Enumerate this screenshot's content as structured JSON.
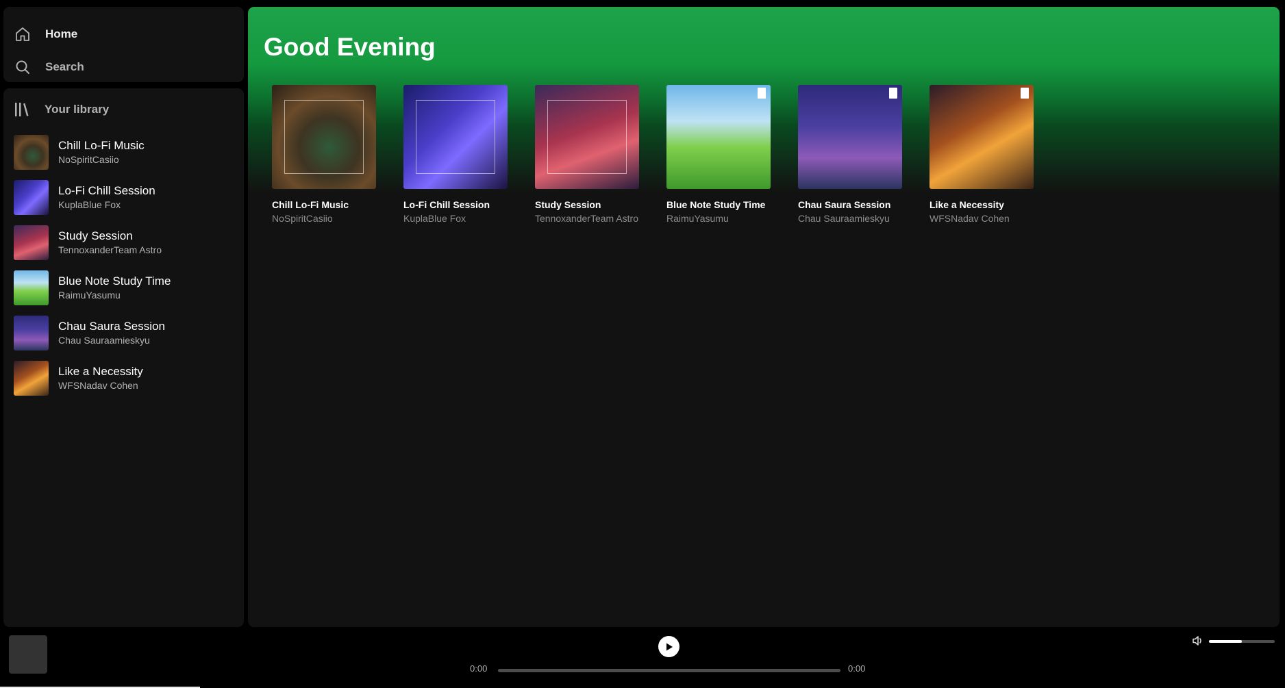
{
  "nav": {
    "home_label": "Home",
    "search_label": "Search"
  },
  "library": {
    "header_label": "Your library",
    "items": [
      {
        "title": "Chill Lo-Fi Music",
        "subtitle": "NoSpiritCasiio"
      },
      {
        "title": "Lo-Fi Chill Session",
        "subtitle": "KuplaBlue Fox"
      },
      {
        "title": "Study Session",
        "subtitle": "TennoxanderTeam Astro"
      },
      {
        "title": "Blue Note Study Time",
        "subtitle": "RaimuYasumu"
      },
      {
        "title": "Chau Saura Session",
        "subtitle": "Chau Sauraamieskyu"
      },
      {
        "title": "Like a Necessity",
        "subtitle": "WFSNadav Cohen"
      }
    ]
  },
  "main": {
    "greeting": "Good Evening",
    "cards": [
      {
        "title": "Chill Lo-Fi Music",
        "subtitle": "NoSpiritCasiio"
      },
      {
        "title": "Lo-Fi Chill Session",
        "subtitle": "KuplaBlue Fox"
      },
      {
        "title": "Study Session",
        "subtitle": "TennoxanderTeam Astro"
      },
      {
        "title": "Blue Note Study Time",
        "subtitle": "RaimuYasumu"
      },
      {
        "title": "Chau Saura Session",
        "subtitle": "Chau Sauraamieskyu"
      },
      {
        "title": "Like a Necessity",
        "subtitle": "WFSNadav Cohen"
      }
    ]
  },
  "player": {
    "elapsed": "0:00",
    "duration": "0:00",
    "progress_fraction": 0,
    "volume_fraction": 0.5
  },
  "icons": {
    "home": "home-icon",
    "search": "search-icon",
    "library": "library-icon",
    "play": "play-icon",
    "volume": "volume-icon"
  },
  "colors": {
    "accent_green": "#1fa24a",
    "panel_bg": "#121212",
    "app_bg": "#000000"
  }
}
